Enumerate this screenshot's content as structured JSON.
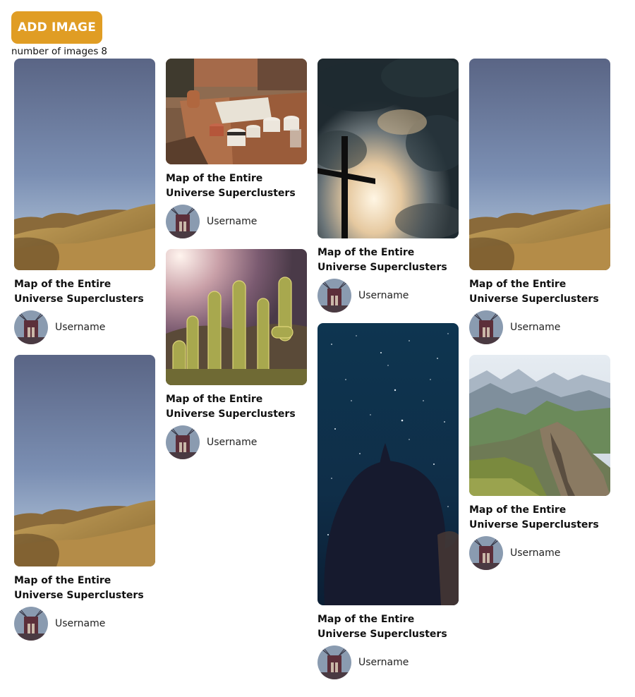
{
  "toolbar": {
    "add_label": "ADD IMAGE",
    "count_label": "number of images",
    "count_value": "8"
  },
  "colors": {
    "accent": "#e09d24"
  },
  "cards": [
    {
      "title": "Map of the Entire Universe Superclusters",
      "username": "Username",
      "image": "desert-hills-photo"
    },
    {
      "title": "Map of the Entire Universe Superclusters",
      "username": "Username",
      "image": "desert-hills-photo"
    },
    {
      "title": "Map of the Entire Universe Superclusters",
      "username": "Username",
      "image": "coffee-cups-photo"
    },
    {
      "title": "Map of the Entire Universe Superclusters",
      "username": "Username",
      "image": "cactus-photo"
    },
    {
      "title": "Map of the Entire Universe Superclusters",
      "username": "Username",
      "image": "cross-clouds-photo"
    },
    {
      "title": "Map of the Entire Universe Superclusters",
      "username": "Username",
      "image": "starry-night-photo"
    },
    {
      "title": "Map of the Entire Universe Superclusters",
      "username": "Username",
      "image": "desert-hills-photo"
    },
    {
      "title": "Map of the Entire Universe Superclusters",
      "username": "Username",
      "image": "mountain-ridge-photo"
    }
  ]
}
